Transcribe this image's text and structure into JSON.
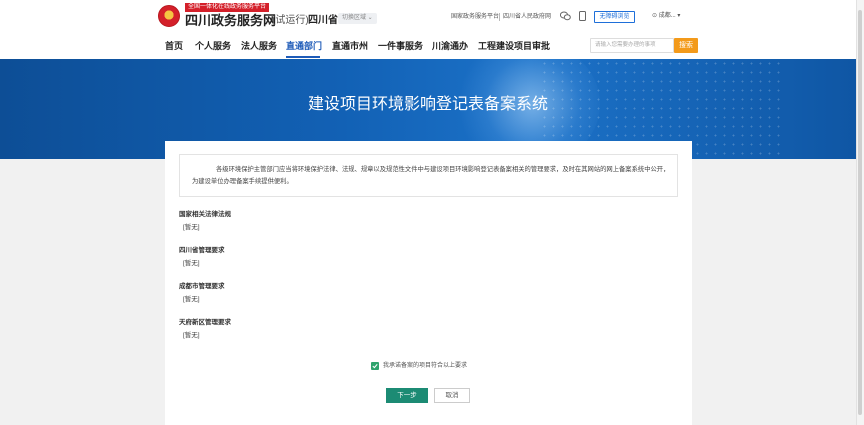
{
  "header": {
    "logo_tag": "全国一体化在线政务服务平台",
    "site_title": "四川政务服务网",
    "trial_label": "(试运行)",
    "province": "四川省",
    "region_switch": "切换区域 ⌄",
    "links": [
      "国家政务服务平台",
      "四川省人民政府网"
    ],
    "accessibility_label": "无障碍浏览",
    "city_label": "成都... ▾"
  },
  "nav": {
    "items": [
      "首页",
      "个人服务",
      "法人服务",
      "直通部门",
      "直通市州",
      "一件事服务",
      "川渝通办",
      "工程建设项目审批"
    ],
    "active_index": 3,
    "search_placeholder": "请输入您需要办理的事项",
    "search_button": "搜索"
  },
  "banner": {
    "title": "建设项目环境影响登记表备案系统"
  },
  "content": {
    "notice": "各级环境保护主管部门应当将环境保护法律、法规、规章以及规范性文件中与建设项目环境影响登记表备案相关的管理要求，及时在其网站的网上备案系统中公开，为建设单位办理备案手续提供便利。",
    "sections": [
      {
        "title": "国家相关法律法规",
        "value": "[暂无]"
      },
      {
        "title": "四川省管理要求",
        "value": "[暂无]"
      },
      {
        "title": "成都市管理要求",
        "value": "[暂无]"
      },
      {
        "title": "天府新区管理要求",
        "value": "[暂无]"
      }
    ],
    "agree_text": "我承诺备案的项目符合以上要求",
    "agree_checked": true,
    "next_button": "下一步",
    "cancel_button": "取消"
  },
  "colors": {
    "brand_blue": "#1e5bb8",
    "banner_blue": "#1261b5",
    "search_orange": "#f39a1a",
    "next_green": "#1c8b74",
    "check_green": "#2ea36d"
  }
}
